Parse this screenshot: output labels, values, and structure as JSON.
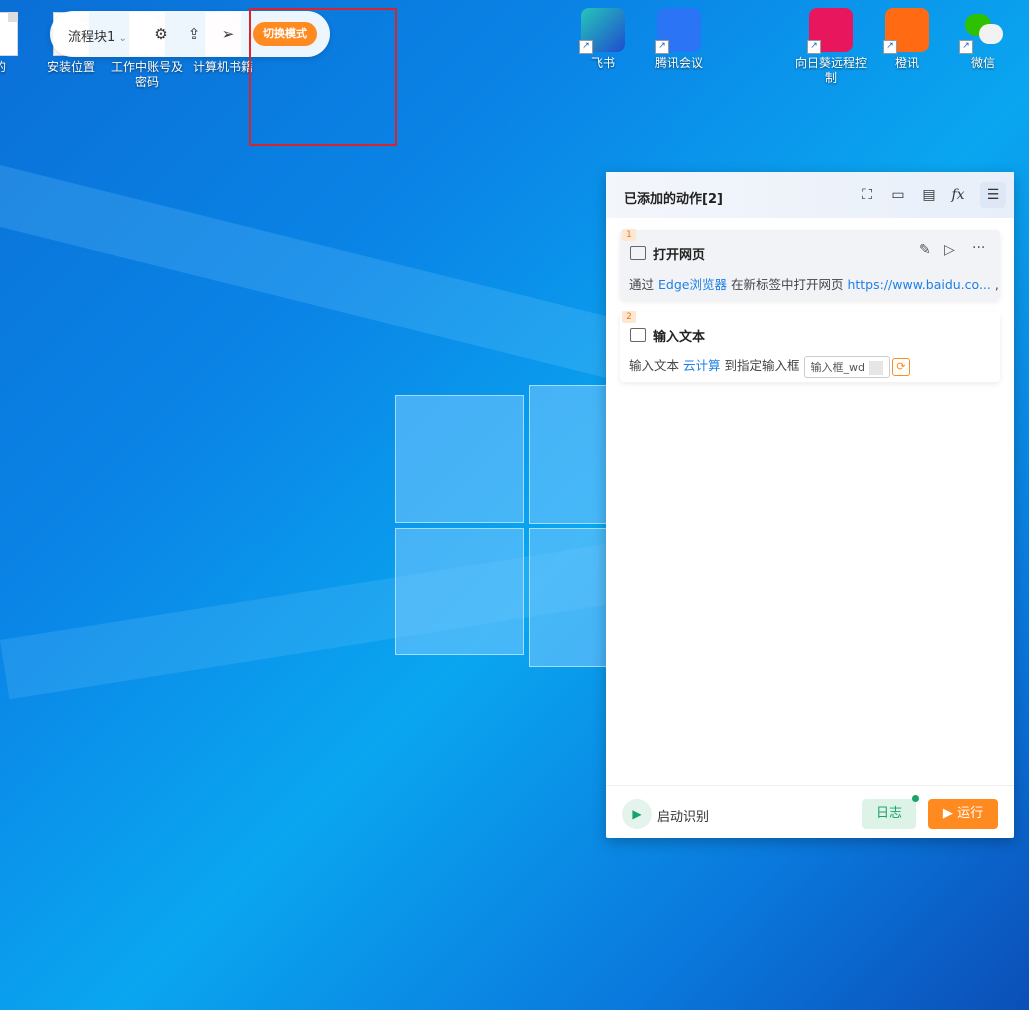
{
  "desktop": {
    "icons_left": [
      {
        "label": "的"
      },
      {
        "label": "安装位置"
      },
      {
        "label": "工作中账号及密码"
      },
      {
        "label": "计算机书籍"
      }
    ],
    "icons_right": [
      {
        "label": "飞书",
        "color": "#1f4ccf"
      },
      {
        "label": "腾讯会议",
        "color": "#2a74f5"
      },
      {
        "label": "向日葵远程控制",
        "color": "#e8175d"
      },
      {
        "label": "橙讯",
        "color": "#ff6a13"
      },
      {
        "label": "微信",
        "color": "#2dc100"
      }
    ]
  },
  "toolbar": {
    "flow_label": "流程块1",
    "switch_mode_label": "切换模式"
  },
  "panel": {
    "title": "已添加的动作[2]",
    "actions": [
      {
        "index": "1",
        "title": "打开网页",
        "desc_prefix": "通过",
        "browser": "Edge浏览器",
        "desc_mid": "在新标签中打开网页",
        "url": "https://www.baidu.co...",
        "desc_suffix": ","
      },
      {
        "index": "2",
        "title": "输入文本",
        "desc_prefix": "输入文本",
        "text_value": "云计算",
        "desc_mid": "到指定输入框",
        "input_target": "输入框_wd"
      }
    ],
    "footer": {
      "start_label": "启动识别",
      "log_label": "日志",
      "run_label": "运行"
    }
  }
}
